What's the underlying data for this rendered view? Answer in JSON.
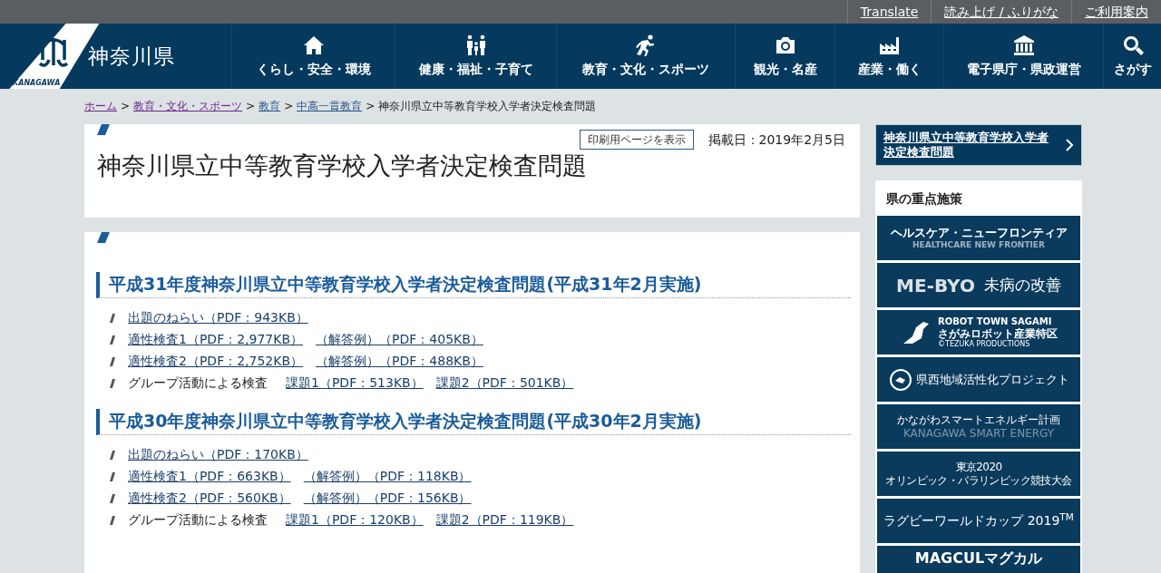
{
  "utility_links": [
    {
      "label": "Translate"
    },
    {
      "label": "読み上げ / ふりがな"
    },
    {
      "label": "ご利用案内"
    }
  ],
  "logo": {
    "name": "神奈川県",
    "caption": "KANAGAWA"
  },
  "nav": [
    {
      "label": "くらし・安全・環境",
      "kind": "home"
    },
    {
      "label": "健康・福祉・子育て",
      "kind": "family"
    },
    {
      "label": "教育・文化・スポーツ",
      "kind": "runner"
    },
    {
      "label": "観光・名産",
      "kind": "camera"
    },
    {
      "label": "産業・働く",
      "kind": "factory"
    },
    {
      "label": "電子県庁・県政運営",
      "kind": "building"
    },
    {
      "label": "さがす",
      "kind": "search"
    }
  ],
  "breadcrumb_separator": ">",
  "breadcrumb": [
    {
      "label": "ホーム",
      "visited": true
    },
    {
      "label": "教育・文化・スポーツ",
      "visited": true
    },
    {
      "label": "教育",
      "visited": false
    },
    {
      "label": "中高一貫教育",
      "visited": false
    },
    {
      "label": "神奈川県立中等教育学校入学者決定検査問題",
      "kind": "current"
    }
  ],
  "page": {
    "print_button": "印刷用ページを表示",
    "published": "掲載日：2019年2月5日",
    "title": "神奈川県立中等教育学校入学者決定検査問題"
  },
  "sections": [
    {
      "heading": "平成31年度神奈川県立中等教育学校入学者決定検査問題(平成31年2月実施)",
      "items": [
        {
          "links": [
            "出題のねらい（PDF：943KB）"
          ]
        },
        {
          "links": [
            "適性検査1（PDF：2,977KB）",
            "（解答例）（PDF：405KB）"
          ]
        },
        {
          "links": [
            "適性検査2（PDF：2,752KB）",
            "（解答例）（PDF：488KB）"
          ]
        },
        {
          "label": "グループ活動による検査",
          "links": [
            "課題1（PDF：513KB）",
            "課題2（PDF：501KB）"
          ]
        }
      ]
    },
    {
      "heading": "平成30年度神奈川県立中等教育学校入学者決定検査問題(平成30年2月実施)",
      "items": [
        {
          "links": [
            "出題のねらい（PDF：170KB）"
          ]
        },
        {
          "links": [
            "適性検査1（PDF：663KB）",
            "（解答例）（PDF：118KB）"
          ]
        },
        {
          "links": [
            "適性検査2（PDF：560KB）",
            "（解答例）（PDF：156KB）"
          ]
        },
        {
          "label": "グループ活動による検査",
          "links": [
            "課題1（PDF：120KB）",
            "課題2（PDF：119KB）"
          ]
        }
      ]
    }
  ],
  "sidebar": {
    "current_link": "神奈川県立中等教育学校入学者決定検査問題",
    "heading": "県の重点施策",
    "banners": [
      {
        "kind": "healthcare",
        "lines": [
          "ヘルスケア・ニューフロンティア",
          "HEALTHCARE NEW FRONTIER"
        ]
      },
      {
        "kind": "mebyo",
        "lines": [
          "ME-BYO",
          "未病の改善"
        ]
      },
      {
        "kind": "robot",
        "lines": [
          "ROBOT TOWN SAGAMI",
          "さがみロボット産業特区",
          "©TEZUKA PRODUCTIONS"
        ]
      },
      {
        "kind": "kensei",
        "lines": [
          "県西地域活性化プロジェクト"
        ]
      },
      {
        "kind": "energy",
        "lines": [
          "かながわスマートエネルギー計画",
          "KANAGAWA SMART ENERGY"
        ]
      },
      {
        "kind": "tokyo",
        "lines": [
          "東京2020",
          "オリンピック・パラリンピック競技大会"
        ]
      },
      {
        "kind": "rugby",
        "lines": [
          "ラグビーワールドカップ 2019$^{TM}$"
        ]
      },
      {
        "kind": "magcul",
        "lines": [
          "MAGCULマグカル"
        ]
      }
    ]
  }
}
